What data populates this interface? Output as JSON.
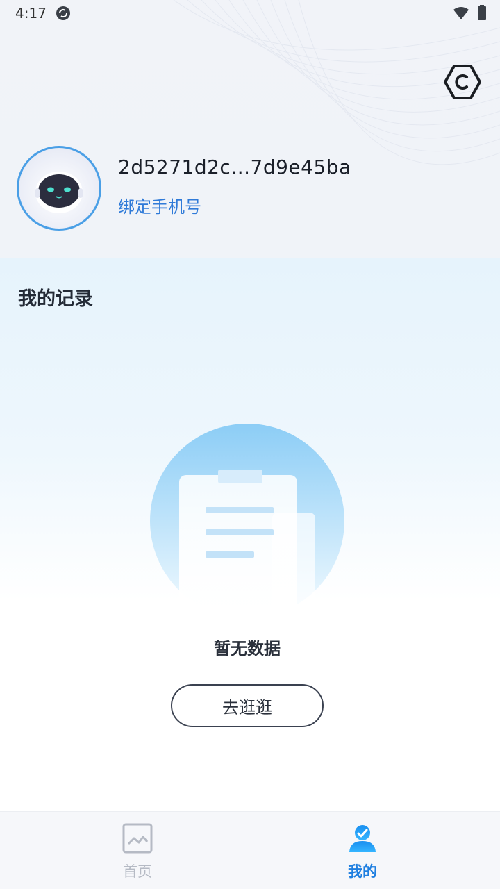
{
  "status_bar": {
    "time": "4:17",
    "icons": [
      "sync-icon",
      "wifi-icon",
      "battery-icon"
    ]
  },
  "header": {
    "settings_icon": "settings-hexagon-icon"
  },
  "profile": {
    "avatar_icon": "robot-avatar-icon",
    "user_id": "2d5271d2c...7d9e45ba",
    "bind_phone_label": "绑定手机号"
  },
  "records": {
    "title": "我的记录",
    "empty_icon": "empty-clipboard-icon",
    "empty_text": "暂无数据",
    "go_button_label": "去逛逛"
  },
  "bottom_nav": {
    "items": [
      {
        "label": "首页",
        "icon": "picture-frame-icon",
        "active": false
      },
      {
        "label": "我的",
        "icon": "user-icon",
        "active": true
      }
    ]
  },
  "colors": {
    "accent": "#1f7fe0",
    "link": "#2f7ad8",
    "inactive_nav": "#b5bac4",
    "avatar_border": "#4a9fe6"
  }
}
